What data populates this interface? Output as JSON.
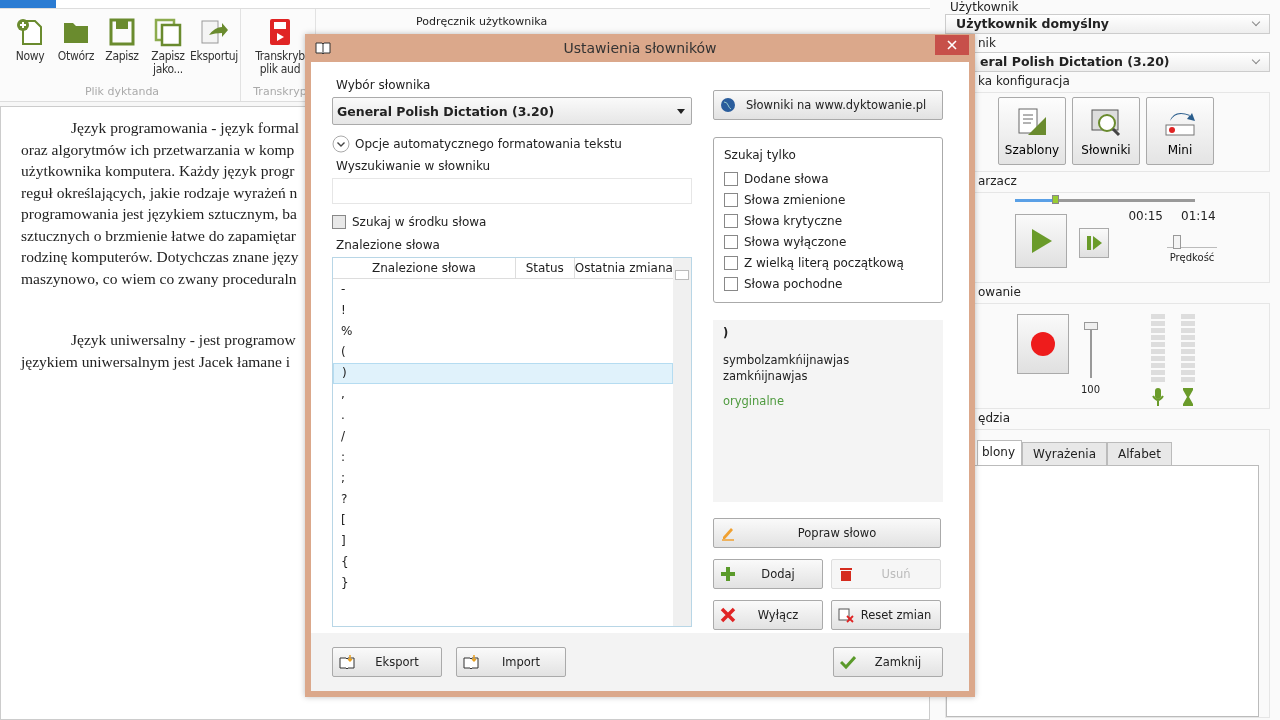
{
  "ribbon": {
    "help_link": "Podręcznik użytkownika",
    "groups": [
      {
        "label": "Plik dyktanda",
        "buttons": [
          "Nowy",
          "Otwórz",
          "Zapisz",
          "Zapisz jako...",
          "Eksportuj"
        ]
      },
      {
        "label": "Transkryp",
        "buttons": [
          "Transkryb plik aud"
        ]
      }
    ]
  },
  "document": {
    "paragraphs": [
      {
        "lines": [
          "Język programowania - język formal",
          "oraz algorytmów ich przetwarzania w komp",
          "użytkownika komputera. Każdy język progr",
          "reguł określających, jakie rodzaje wyrażeń n",
          "programowania jest językiem sztucznym, ba",
          "sztucznych o brzmienie łatwe do zapamiętar",
          "rodzinę komputerów. Dotychczas znane języ",
          "maszynowo, co wiem co zwany proceduraln"
        ]
      },
      {
        "lines": [
          "Język uniwersalny - jest programow",
          "językiem uniwersalnym jest Jacek łamane i"
        ]
      }
    ]
  },
  "side_panel": {
    "user_label": "Użytkownik",
    "user_value": "Użytkownik domyślny",
    "dict_label": "nik",
    "dict_value": "eral Polish Dictation (3.20)",
    "config": {
      "title": "ka konfiguracja",
      "buttons": [
        "Szablony",
        "Słowniki",
        "Mini"
      ]
    },
    "player": {
      "title": "arzacz",
      "level": 0.22,
      "elapsed": "00:15",
      "total": "01:14",
      "speed": {
        "label": "Prędkość",
        "level": 0.2
      }
    },
    "recording": {
      "title": "owanie",
      "volume": {
        "label": "100",
        "level": 1
      }
    },
    "tools": {
      "title": "ędzia",
      "tabs": [
        {
          "label": "blony",
          "selected": true
        },
        {
          "label": "Wyrażenia",
          "selected": false
        },
        {
          "label": "Alfabet",
          "selected": false
        }
      ]
    }
  },
  "dialog": {
    "title": "Ustawienia słowników",
    "dictionary_label": "Wybór słownika",
    "dictionary_value": "General Polish Dictation (3.20)",
    "expander": {
      "label": "Opcje automatycznego formatowania tekstu",
      "expanded": false
    },
    "search_label": "Wyszukiwanie w słowniku",
    "search_inside": {
      "label": "Szukaj w środku słowa",
      "checked": false
    },
    "found_label": "Znalezione słowa",
    "table": {
      "columns": [
        "Znalezione słowa",
        "Status",
        "Ostatnia zmiana"
      ],
      "rows": [
        {
          "word": "-",
          "selected": false
        },
        {
          "word": "!",
          "selected": false
        },
        {
          "word": "%",
          "selected": false
        },
        {
          "word": "(",
          "selected": false
        },
        {
          "word": ")",
          "selected": true
        },
        {
          "word": ",",
          "selected": false
        },
        {
          "word": ".",
          "selected": false
        },
        {
          "word": "/",
          "selected": false
        },
        {
          "word": ":",
          "selected": false
        },
        {
          "word": ";",
          "selected": false
        },
        {
          "word": "?",
          "selected": false
        },
        {
          "word": "[",
          "selected": false
        },
        {
          "word": "]",
          "selected": false
        },
        {
          "word": "{",
          "selected": false
        },
        {
          "word": "}",
          "selected": false
        }
      ]
    },
    "web_button": "Słowniki na www.dyktowanie.pl",
    "filter": {
      "title": "Szukaj tylko",
      "options": [
        {
          "label": "Dodane słowa",
          "checked": false
        },
        {
          "label": "Słowa zmienione",
          "checked": false
        },
        {
          "label": "Słowa krytyczne",
          "checked": false
        },
        {
          "label": "Słowa wyłączone",
          "checked": false
        },
        {
          "label": "Z wielką literą początkową",
          "checked": false
        },
        {
          "label": "Słowa pochodne",
          "checked": false
        }
      ]
    },
    "details": {
      "word": ")",
      "forms": "symbolzamkńijnawjas zamkńijnawjas",
      "status": "oryginalne"
    },
    "actions": [
      {
        "label": "Popraw słowo",
        "disabled": false
      },
      {
        "label": "Dodaj",
        "disabled": false
      },
      {
        "label": "Usuń",
        "disabled": true
      },
      {
        "label": "Wyłącz",
        "disabled": false
      },
      {
        "label": "Reset zmian",
        "disabled": false
      }
    ],
    "footer": [
      {
        "label": "Eksport",
        "kind": "left"
      },
      {
        "label": "Import",
        "kind": "left"
      },
      {
        "label": "Zamknij",
        "kind": "right"
      }
    ]
  }
}
